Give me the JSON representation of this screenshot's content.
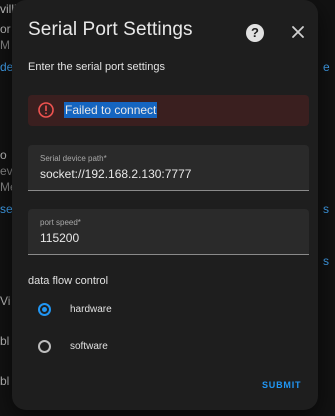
{
  "background": {
    "fragments": [
      "villi",
      "or",
      "M",
      "de",
      "e",
      "o",
      "ev",
      "Me",
      "se",
      "s",
      "s",
      "Vi",
      "bl",
      "bl"
    ]
  },
  "dialog": {
    "title": "Serial Port Settings",
    "help_icon": "help-circle-icon",
    "close_icon": "close-icon",
    "subtitle": "Enter the serial port settings",
    "error": {
      "icon": "alert-circle-icon",
      "message": "Failed to connect"
    },
    "serial_path": {
      "label": "Serial device path*",
      "value": "socket://192.168.2.130:7777"
    },
    "port_speed": {
      "label": "port speed*",
      "value": "115200"
    },
    "flow_control": {
      "label": "data flow control",
      "options": [
        {
          "label": "hardware",
          "checked": true
        },
        {
          "label": "software",
          "checked": false
        }
      ]
    },
    "submit_label": "SUBMIT"
  },
  "colors": {
    "accent": "#2196f3",
    "error_bg": "#3a1f1f",
    "error_icon": "#ef5350",
    "surface": "#1e1e1e"
  }
}
